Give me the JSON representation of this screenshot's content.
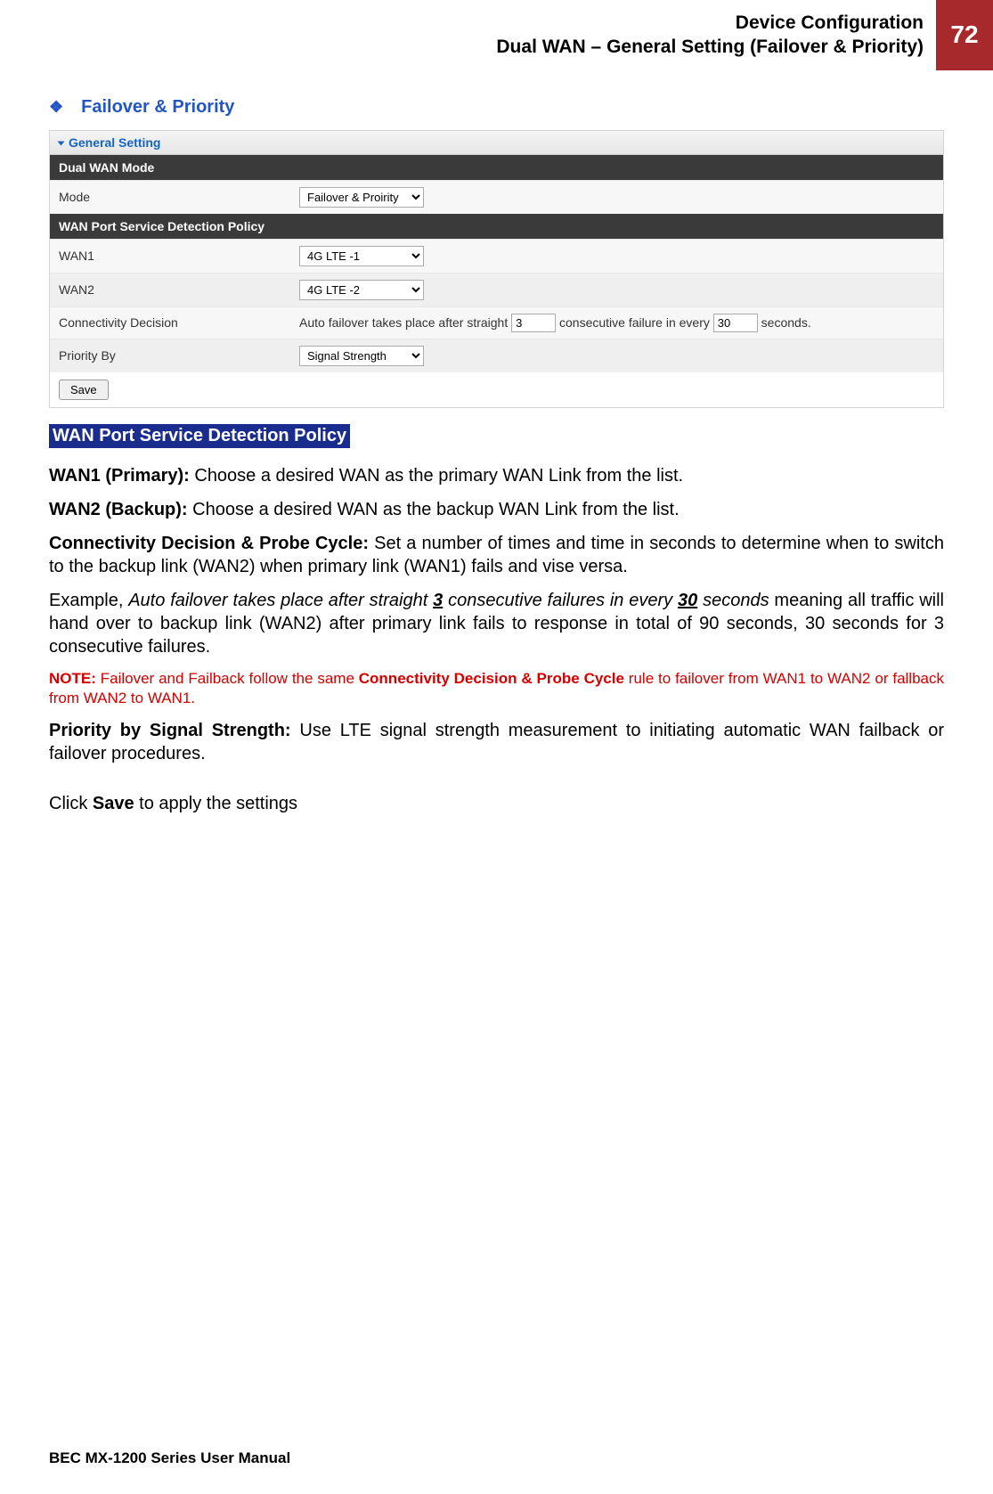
{
  "header": {
    "line1": "Device Configuration",
    "line2": "Dual WAN – General Setting (Failover & Priority)",
    "page": "72"
  },
  "section_title": "Failover & Priority",
  "screenshot": {
    "panel_title": "General Setting",
    "dual_wan_mode_header": "Dual WAN Mode",
    "mode_label": "Mode",
    "mode_value": "Failover & Proirity",
    "wan_policy_header": "WAN Port Service Detection Policy",
    "wan1_label": "WAN1",
    "wan1_value": "4G LTE -1",
    "wan2_label": "WAN2",
    "wan2_value": "4G LTE -2",
    "conn_label": "Connectivity Decision",
    "conn_text_pre": "Auto failover takes place after straight",
    "conn_val1": "3",
    "conn_text_mid": "consecutive failure in every",
    "conn_val2": "30",
    "conn_text_post": "seconds.",
    "priority_label": "Priority By",
    "priority_value": "Signal Strength",
    "save_btn": "Save"
  },
  "policy_heading": "WAN Port Service Detection Policy",
  "p_wan1_b": "WAN1 (Primary):",
  "p_wan1_t": " Choose a desired WAN as the primary WAN Link from the list.",
  "p_wan2_b": "WAN2 (Backup):",
  "p_wan2_t": " Choose a desired WAN as the backup WAN Link from the list.",
  "p_conn_b": "Connectivity Decision & Probe Cycle:",
  "p_conn_t": " Set a number of times and time in seconds to determine when to switch to the backup link (WAN2) when primary link (WAN1) fails and vise versa.",
  "p_ex_pre": "Example, ",
  "p_ex_i1": "Auto failover takes place after straight ",
  "p_ex_u1": "3",
  "p_ex_i2": " consecutive failures in every ",
  "p_ex_u2": "30",
  "p_ex_i3": " seconds",
  "p_ex_post": " meaning all traffic will hand over to backup link (WAN2) after primary link fails to response in total of 90 seconds, 30 seconds for 3 consecutive failures.",
  "note_b1": "NOTE:",
  "note_t1": " Failover and Failback follow the same ",
  "note_b2": "Connectivity Decision & Probe Cycle",
  "note_t2": " rule to failover from WAN1 to WAN2 or fallback from WAN2 to WAN1.",
  "p_pri_b": "Priority by Signal Strength:",
  "p_pri_t": " Use LTE signal strength measurement to initiating automatic WAN failback or failover procedures.",
  "p_save_pre": "Click ",
  "p_save_b": "Save",
  "p_save_post": " to apply the settings",
  "footer": "BEC MX-1200 Series User Manual"
}
